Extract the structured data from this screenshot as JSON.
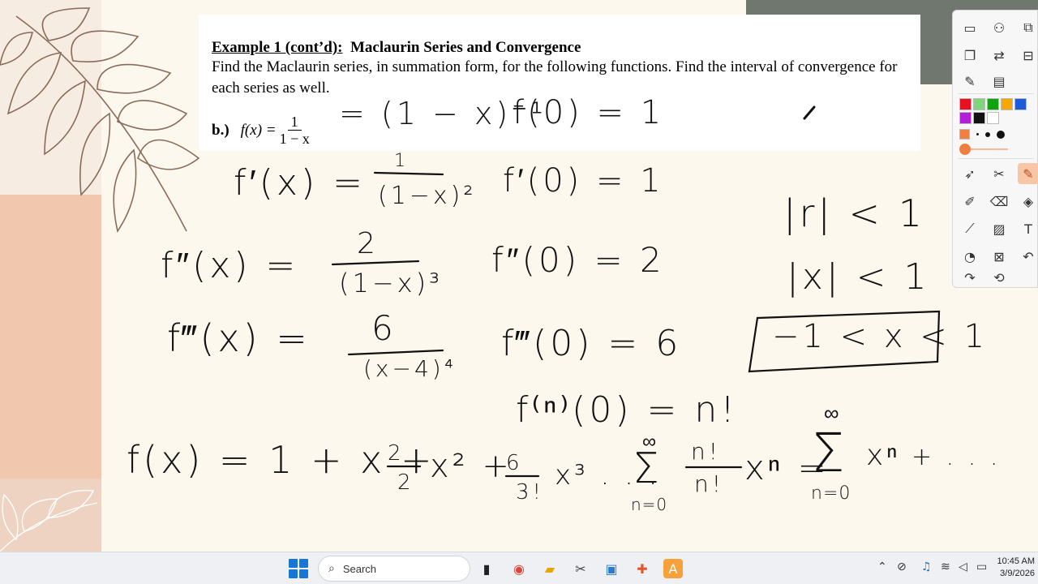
{
  "document": {
    "title_underlined": "Example 1 (cont’d):",
    "title_rest": "Maclaurin Series and Convergence",
    "instructions": "Find the Maclaurin series, in summation form, for the following functions.  Find the interval of convergence for each series as well.",
    "part_label": "b.)",
    "function_lhs": "f(x) =",
    "function_numerator": "1",
    "function_denominator": "1 − x"
  },
  "handwriting": {
    "rewrite": "= (1 − x)⁻¹",
    "f0": "f(0) = 1",
    "f1x_lhs": "f′(x) =",
    "f1x_num": "1",
    "f1x_den": "(1−x)²",
    "f10": "f′(0) = 1",
    "f2x_lhs": "f″(x) =",
    "f2x_num": "2",
    "f2x_den": "(1−x)³",
    "f20": "f″(0) = 2",
    "f3x_lhs": "f‴(x) =",
    "f3x_num": "6",
    "f3x_den": "(x−4)⁴",
    "f30": "f‴(0) = 6",
    "fn0": "f⁽ⁿ⁾(0) = n!",
    "r_cond": "|r| < 1",
    "x_cond": "|x| < 1",
    "interval": "−1 < x < 1",
    "series_start": "f(x) = 1 + x +",
    "term2_num": "2",
    "term2_den": "2",
    "term2_var": "x² +",
    "term3_num": "6",
    "term3_den": "3!",
    "term3_var": "x³ . . .",
    "sum1_top": "∞",
    "sum1_bottom": "n=0",
    "sum1_num": "n!",
    "sum1_den": "n!",
    "sum1_var": "xⁿ =",
    "sum2_top": "∞",
    "sum2_bottom": "n=0",
    "sum2_var": "xⁿ",
    "tail": "+ . . ."
  },
  "toolbar": {
    "colors": [
      "#e81123",
      "#7fd67a",
      "#10a310",
      "#f7a800",
      "#1e5bdc",
      "#b31fd6",
      "#111111",
      "#ffffff"
    ],
    "accent": "#f08040"
  },
  "taskbar": {
    "search_placeholder": "Search",
    "time": "10:45 AM",
    "date": "3/9/2026"
  }
}
